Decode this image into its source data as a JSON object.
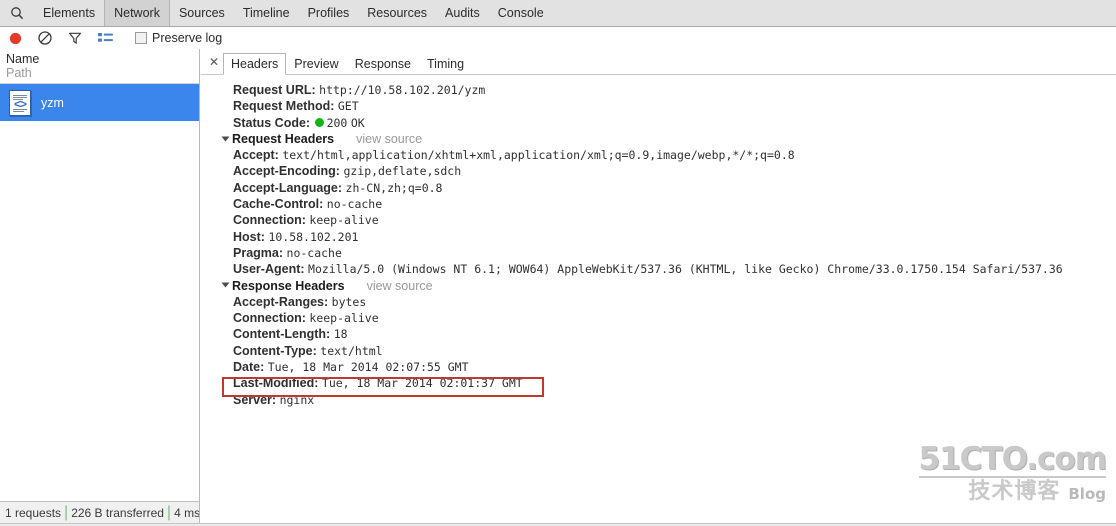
{
  "menubar": {
    "search_icon": "search-icon",
    "tabs": [
      {
        "label": "Elements",
        "selected": false
      },
      {
        "label": "Network",
        "selected": true
      },
      {
        "label": "Sources",
        "selected": false
      },
      {
        "label": "Timeline",
        "selected": false
      },
      {
        "label": "Profiles",
        "selected": false
      },
      {
        "label": "Resources",
        "selected": false
      },
      {
        "label": "Audits",
        "selected": false
      },
      {
        "label": "Console",
        "selected": false
      }
    ]
  },
  "toolbar": {
    "record_icon": "record-circle-icon",
    "clear_icon": "clear-no-entry-icon",
    "filter_icon": "filter-funnel-icon",
    "list_icon": "list-view-icon",
    "preserve_log_label": "Preserve log",
    "preserve_log_checked": false,
    "record_color": "#e23b2e",
    "list_icon_color": "#4a7fc1"
  },
  "left_pane": {
    "column_name": "Name",
    "column_path": "Path",
    "rows": [
      {
        "label": "yzm",
        "icon": "source-document-icon",
        "icon_glyph": "<>",
        "selected": true
      }
    ],
    "selection_color": "#3b86ec"
  },
  "statusbar": {
    "requests": "1 requests",
    "transferred": "226 B transferred",
    "time": "4 ms ...",
    "separator": "|"
  },
  "detail_pane": {
    "close_icon": "close-icon",
    "close_glyph": "✕",
    "tabs": [
      {
        "label": "Headers",
        "selected": true
      },
      {
        "label": "Preview",
        "selected": false
      },
      {
        "label": "Response",
        "selected": false
      },
      {
        "label": "Timing",
        "selected": false
      }
    ],
    "general": [
      {
        "key": "Request URL:",
        "value": "http://10.58.102.201/yzm"
      },
      {
        "key": "Request Method:",
        "value": "GET"
      }
    ],
    "status_code": {
      "key": "Status Code:",
      "dot": "green-status-dot",
      "dot_color": "#13b413",
      "code": "200",
      "text": "OK"
    },
    "request_headers": {
      "title": "Request Headers",
      "view_source": "view source",
      "expanded": true,
      "rows": [
        {
          "key": "Accept:",
          "value": "text/html,application/xhtml+xml,application/xml;q=0.9,image/webp,*/*;q=0.8"
        },
        {
          "key": "Accept-Encoding:",
          "value": "gzip,deflate,sdch"
        },
        {
          "key": "Accept-Language:",
          "value": "zh-CN,zh;q=0.8"
        },
        {
          "key": "Cache-Control:",
          "value": "no-cache"
        },
        {
          "key": "Connection:",
          "value": "keep-alive"
        },
        {
          "key": "Host:",
          "value": "10.58.102.201"
        },
        {
          "key": "Pragma:",
          "value": "no-cache"
        },
        {
          "key": "User-Agent:",
          "value": "Mozilla/5.0 (Windows NT 6.1; WOW64) AppleWebKit/537.36 (KHTML, like Gecko) Chrome/33.0.1750.154 Safari/537.36"
        }
      ]
    },
    "response_headers": {
      "title": "Response Headers",
      "view_source": "view source",
      "expanded": true,
      "rows": [
        {
          "key": "Accept-Ranges:",
          "value": "bytes"
        },
        {
          "key": "Connection:",
          "value": "keep-alive"
        },
        {
          "key": "Content-Length:",
          "value": "18"
        },
        {
          "key": "Content-Type:",
          "value": "text/html"
        },
        {
          "key": "Date:",
          "value": "Tue, 18 Mar 2014 02:07:55 GMT"
        },
        {
          "key": "Last-Modified:",
          "value": "Tue, 18 Mar 2014 02:01:37 GMT"
        },
        {
          "key": "Server:",
          "value": "nginx"
        }
      ]
    },
    "annotation": {
      "target": "Last-Modified",
      "color": "#c0392b"
    }
  },
  "watermark": {
    "main": "51CTO.com",
    "cn": "技术博客",
    "blog": "Blog"
  }
}
